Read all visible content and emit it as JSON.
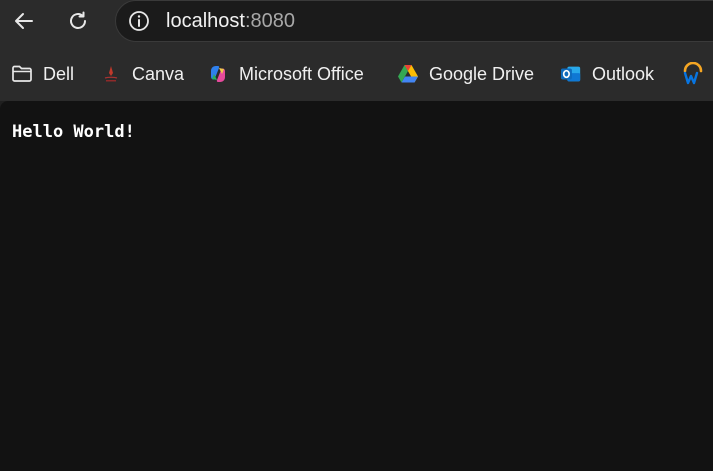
{
  "browser": {
    "url_host": "localhost",
    "url_port": ":8080",
    "icons": {
      "back": "back-arrow-icon",
      "reload": "reload-icon",
      "site_info": "info-icon"
    }
  },
  "bookmarks": [
    {
      "label": "Dell",
      "icon": "folder-icon"
    },
    {
      "label": "Canva",
      "icon": "canva-icon"
    },
    {
      "label": "Microsoft Office",
      "icon": "microsoft-office-icon"
    },
    {
      "label": "Google Drive",
      "icon": "google-drive-icon"
    },
    {
      "label": "Outlook",
      "icon": "outlook-icon"
    },
    {
      "label": "",
      "icon": "workday-icon"
    }
  ],
  "page": {
    "text": "Hello World!"
  },
  "colors": {
    "chrome_bg": "#2b2b2b",
    "content_bg": "#121212",
    "address_bg": "#1b1b1b",
    "outlook_blue": "#0f6cbd"
  }
}
